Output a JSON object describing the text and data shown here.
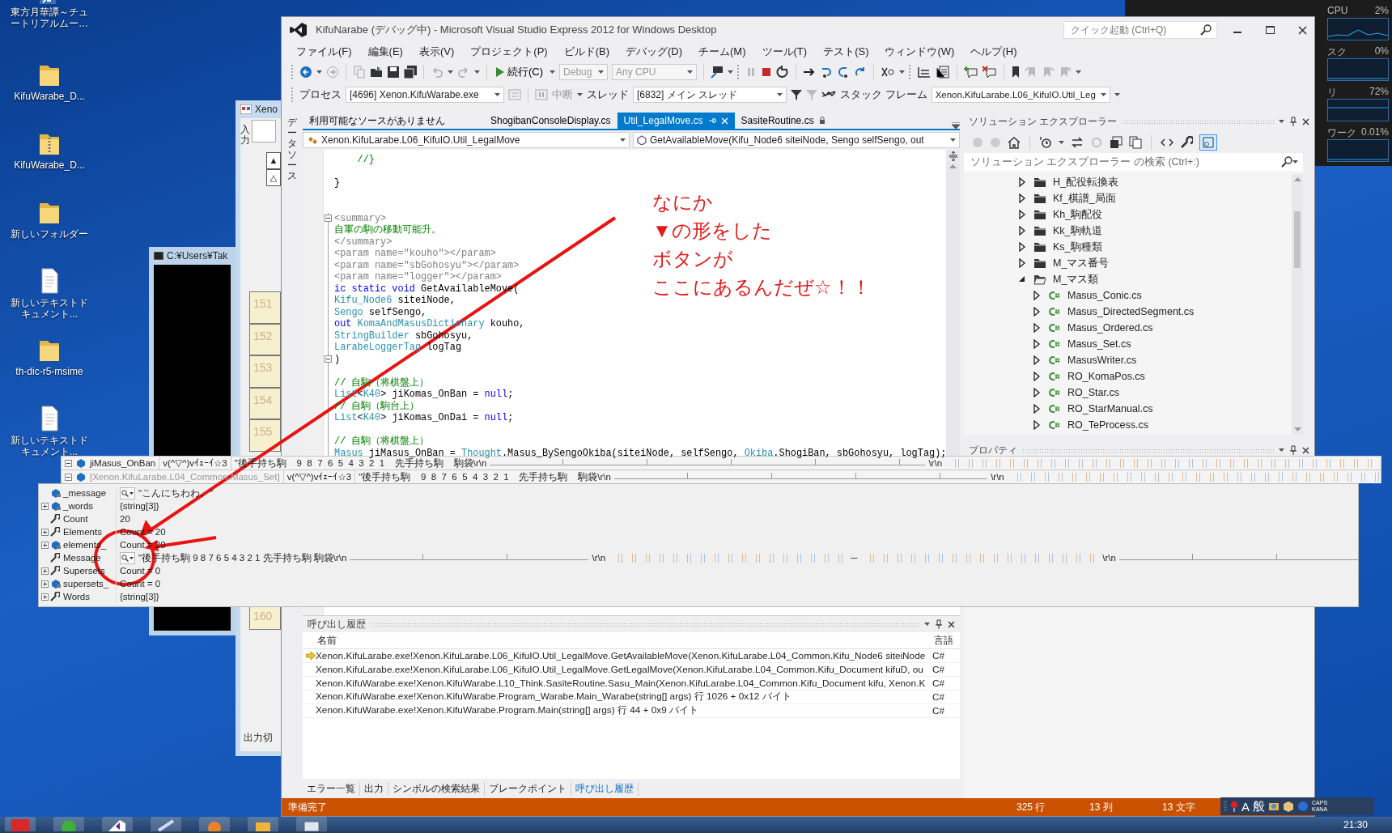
{
  "desktop_icons": [
    {
      "label": "東方月華譚～チュートリアルムー…",
      "kind": "shortcut"
    },
    {
      "label": "KifuWarabe_D...",
      "kind": "folder"
    },
    {
      "label": "KifuWarabe_D...",
      "kind": "zip"
    },
    {
      "label": "新しいフォルダー",
      "kind": "folder"
    },
    {
      "label": "新しいテキストドキュメント...",
      "kind": "text"
    },
    {
      "label": "th-dic-r5-msime",
      "kind": "folder"
    },
    {
      "label": "新しいテキストドキュメント...",
      "kind": "text"
    }
  ],
  "resource_monitor": [
    {
      "label": "CPU",
      "value": "2%"
    },
    {
      "label": "スク",
      "value": "0%"
    },
    {
      "label": "リ",
      "value": "72%"
    },
    {
      "label": "ワーク",
      "value": "0.01%"
    }
  ],
  "console_window": {
    "title": "C:¥Users¥Tak"
  },
  "xenon_window": {
    "title": "Xeno",
    "input_label": "入力",
    "marks": [
      "▲",
      "△"
    ],
    "cells": [
      "151",
      "152",
      "153",
      "154",
      "155",
      "160"
    ],
    "output_label": "出力切"
  },
  "window": {
    "title": "KifuNarabe (デバッグ中) - Microsoft Visual Studio Express 2012 for Windows Desktop",
    "quick_launch": {
      "placeholder": "クイック起動 (Ctrl+Q)"
    },
    "menu": [
      "ファイル(F)",
      "編集(E)",
      "表示(V)",
      "プロジェクト(P)",
      "ビルド(B)",
      "デバッグ(D)",
      "チーム(M)",
      "ツール(T)",
      "テスト(S)",
      "ウィンドウ(W)",
      "ヘルプ(H)"
    ],
    "toolbar": {
      "continue": "続行(C)",
      "configuration": "Debug",
      "platform": "Any CPU"
    },
    "debug_location": {
      "process_label": "プロセス",
      "process": "[4696] Xenon.KifuWarabe.exe",
      "suspend": "中断",
      "thread_label": "スレッド",
      "thread": "[6832] メイン スレッド",
      "stack_frame_label": "スタック フレーム",
      "stack_frame": "Xenon.KifuLarabe.L06_KifuIO.Util_Leg"
    },
    "side_tab": "データソース",
    "editor_tabs": [
      {
        "label": "利用可能なソースがありません",
        "selected": false,
        "kind": "plain"
      },
      {
        "label": "ShogibanConsoleDisplay.cs",
        "selected": false,
        "kind": "plain"
      },
      {
        "label": "Util_LegalMove.cs",
        "selected": true,
        "kind": "plain"
      },
      {
        "label": "SasiteRoutine.cs",
        "selected": false,
        "kind": "readonly"
      }
    ],
    "navigation": {
      "type": "Xenon.KifuLarabe.L06_KifuIO.Util_LegalMove",
      "member": "GetAvailableMove(Kifu_Node6 siteiNode, Sengo selfSengo, out"
    },
    "code_lines": [
      {
        "fold": false,
        "tokens": [
          {
            "kind": "comment",
            "text": "    //}"
          }
        ]
      },
      {
        "fold": false
      },
      {
        "fold": false,
        "tokens": [
          {
            "kind": "plain",
            "text": "}"
          }
        ]
      },
      {
        "fold": false
      },
      {
        "fold": false
      },
      {
        "fold": true,
        "tokens": [
          {
            "kind": "doc",
            "text": "<summary>"
          }
        ]
      },
      {
        "fold": false,
        "tokens": [
          {
            "kind": "comment",
            "text": "自軍の駒の移動可能升。"
          }
        ]
      },
      {
        "fold": false,
        "tokens": [
          {
            "kind": "doc",
            "text": "</summary>"
          }
        ]
      },
      {
        "fold": false,
        "tokens": [
          {
            "kind": "doc",
            "text": "<param name=\"kouho\"></param>"
          }
        ]
      },
      {
        "fold": false,
        "tokens": [
          {
            "kind": "doc",
            "text": "<param name=\"sbGohosyu\"></param>"
          }
        ]
      },
      {
        "fold": false,
        "tokens": [
          {
            "kind": "doc",
            "text": "<param name=\"logger\"></param>"
          }
        ]
      },
      {
        "fold": false,
        "tokens": [
          {
            "kind": "kw",
            "text": "ic static void"
          },
          {
            "kind": "plain",
            "text": " GetAvailableMove("
          }
        ]
      },
      {
        "fold": false,
        "tokens": [
          {
            "kind": "type",
            "text": "Kifu_Node6"
          },
          {
            "kind": "plain",
            "text": " siteiNode,"
          }
        ]
      },
      {
        "fold": false,
        "tokens": [
          {
            "kind": "type",
            "text": "Sengo"
          },
          {
            "kind": "plain",
            "text": " selfSengo,"
          }
        ]
      },
      {
        "fold": false,
        "tokens": [
          {
            "kind": "kw",
            "text": "out "
          },
          {
            "kind": "type",
            "text": "KomaAndMasusDictionary"
          },
          {
            "kind": "plain",
            "text": " kouho,"
          }
        ]
      },
      {
        "fold": false,
        "tokens": [
          {
            "kind": "type",
            "text": "StringBuilder"
          },
          {
            "kind": "plain",
            "text": " sbGohosyu,"
          }
        ]
      },
      {
        "fold": false,
        "tokens": [
          {
            "kind": "type",
            "text": "LarabeLoggerTag"
          },
          {
            "kind": "plain",
            "text": " logTag"
          }
        ]
      },
      {
        "fold": true,
        "tokens": [
          {
            "kind": "plain",
            "text": ")"
          }
        ]
      },
      {
        "fold": false
      },
      {
        "fold": false,
        "tokens": [
          {
            "kind": "comment",
            "text": "// 自駒（将棋盤上）"
          }
        ]
      },
      {
        "fold": false,
        "tokens": [
          {
            "kind": "type",
            "text": "List"
          },
          {
            "kind": "plain",
            "text": "<"
          },
          {
            "kind": "type",
            "text": "K40"
          },
          {
            "kind": "plain",
            "text": "> jiKomas_OnBan = "
          },
          {
            "kind": "kw",
            "text": "null"
          },
          {
            "kind": "plain",
            "text": ";"
          }
        ]
      },
      {
        "fold": false,
        "tokens": [
          {
            "kind": "comment",
            "text": "// 自駒（駒台上）"
          }
        ]
      },
      {
        "fold": false,
        "tokens": [
          {
            "kind": "type",
            "text": "List"
          },
          {
            "kind": "plain",
            "text": "<"
          },
          {
            "kind": "type",
            "text": "K40"
          },
          {
            "kind": "plain",
            "text": "> jiKomas_OnDai = "
          },
          {
            "kind": "kw",
            "text": "null"
          },
          {
            "kind": "plain",
            "text": ";"
          }
        ]
      },
      {
        "fold": false
      },
      {
        "fold": false,
        "tokens": [
          {
            "kind": "comment",
            "text": "// 自駒（将棋盤上）"
          }
        ]
      },
      {
        "fold": false,
        "tokens": [
          {
            "kind": "type",
            "text": "Masus"
          },
          {
            "kind": "plain",
            "text": " jiMasus_OnBan = "
          },
          {
            "kind": "type",
            "text": "Thought"
          },
          {
            "kind": "plain",
            "text": ".Masus_BySengoOkiba(siteiNode, selfSengo, "
          },
          {
            "kind": "type",
            "text": "Okiba"
          },
          {
            "kind": "plain",
            "text": ".ShogiBan, sbGohosyu, logTag);"
          }
        ]
      }
    ],
    "solution_explorer": {
      "title": "ソリューション エクスプローラー",
      "search": {
        "placeholder": "ソリューション エクスプローラー の検索 (Ctrl+:)"
      },
      "tree": [
        {
          "label": "H_配役転換表",
          "kind": "folder",
          "expanded": false
        },
        {
          "label": "Kf_棋譜_局面",
          "kind": "folder",
          "expanded": false
        },
        {
          "label": "Kh_駒配役",
          "kind": "folder",
          "expanded": false
        },
        {
          "label": "Kk_駒軌道",
          "kind": "folder",
          "expanded": false
        },
        {
          "label": "Ks_駒種類",
          "kind": "folder",
          "expanded": false
        },
        {
          "label": "M_マス番号",
          "kind": "folder",
          "expanded": false
        },
        {
          "label": "M_マス類",
          "kind": "folder",
          "expanded": true,
          "children": [
            {
              "label": "Masus_Conic.cs",
              "kind": "cs",
              "expanded": false
            },
            {
              "label": "Masus_DirectedSegment.cs",
              "kind": "cs",
              "expanded": false
            },
            {
              "label": "Masus_Ordered.cs",
              "kind": "cs",
              "expanded": false
            },
            {
              "label": "Masus_Set.cs",
              "kind": "cs",
              "expanded": false
            },
            {
              "label": "MasusWriter.cs",
              "kind": "cs",
              "expanded": false
            },
            {
              "label": "RO_KomaPos.cs",
              "kind": "cs",
              "expanded": false
            },
            {
              "label": "RO_Star.cs",
              "kind": "cs",
              "expanded": false
            },
            {
              "label": "RO_StarManual.cs",
              "kind": "cs",
              "expanded": false
            },
            {
              "label": "RO_TeProcess.cs",
              "kind": "cs",
              "expanded": false
            }
          ]
        }
      ]
    },
    "properties": {
      "title": "プロパティ"
    },
    "call_stack": {
      "title": "呼び出し履歴",
      "columns": [
        "名前",
        "言語"
      ],
      "rows": [
        {
          "name": "Xenon.KifuLarabe.exe!Xenon.KifuLarabe.L06_KifuIO.Util_LegalMove.GetAvailableMove(Xenon.KifuLarabe.L04_Common.Kifu_Node6 siteiNode",
          "language": "C#",
          "current": true
        },
        {
          "name": "Xenon.KifuLarabe.exe!Xenon.KifuLarabe.L06_KifuIO.Util_LegalMove.GetLegalMove(Xenon.KifuLarabe.L04_Common.Kifu_Document kifuD, ou",
          "language": "C#",
          "current": false
        },
        {
          "name": "Xenon.KifuWarabe.exe!Xenon.KifuWarabe.L10_Think.SasiteRoutine.Sasu_Main(Xenon.KifuLarabe.L04_Common.Kifu_Document kifu, Xenon.K",
          "language": "C#",
          "current": false
        },
        {
          "name": "Xenon.KifuWarabe.exe!Xenon.KifuWarabe.Program_Warabe.Main_Warabe(string[] args) 行 1026 + 0x12 バイト",
          "language": "C#",
          "current": false
        },
        {
          "name": "Xenon.KifuWarabe.exe!Xenon.KifuWarabe.Program.Main(string[] args) 行 44 + 0x9 バイト",
          "language": "C#",
          "current": false
        }
      ]
    },
    "bottom_tabs": [
      {
        "label": "エラー一覧",
        "selected": false
      },
      {
        "label": "出力",
        "selected": false
      },
      {
        "label": "シンボルの検索結果",
        "selected": false
      },
      {
        "label": "ブレークポイント",
        "selected": false
      },
      {
        "label": "呼び出し履歴",
        "selected": true
      }
    ],
    "status_bar": {
      "message": "準備完了",
      "line": "325 行",
      "column": "13 列",
      "char": "13 文字"
    }
  },
  "annotation": [
    "なにか",
    "▼の形をした",
    "ボタンが",
    "ここにあるんだぜ☆！！"
  ],
  "datatip": {
    "pinned": [
      {
        "name": "jiMasus_OnBan",
        "value": "v(^▽^)vｲｪｰｲ☆3",
        "dim": false,
        "segments": [
          {
            "kind": "text",
            "text": "\"後手持ち駒    9  8  7  6  5  4  3  2  1    先手持ち駒    駒袋\\r\\n"
          },
          {
            "kind": "rule"
          },
          {
            "kind": "text",
            "text": "\\r\\n"
          },
          {
            "kind": "ticks"
          }
        ]
      },
      {
        "name": "[Xenon.KifuLarabe.L04_Common.Masus_Set]",
        "value": "v(^▽^)vｲｪｰｲ☆3",
        "dim": true,
        "segments": [
          {
            "kind": "text",
            "text": "\"後手持ち駒    9  8  7  6  5  4  3  2  1    先手持ち駒    駒袋\\r\\n"
          },
          {
            "kind": "rule"
          },
          {
            "kind": "text",
            "text": "\\r\\n"
          },
          {
            "kind": "ticks"
          }
        ]
      }
    ],
    "members": [
      {
        "name": "_message",
        "kind": "field",
        "expandable": false,
        "visualizer": true,
        "segments": [
          {
            "kind": "text",
            "text": "\"こんにちわわ。\""
          }
        ]
      },
      {
        "name": "_words",
        "kind": "field",
        "expandable": true,
        "visualizer": false,
        "segments": [
          {
            "kind": "text",
            "text": "{string[3]}"
          }
        ]
      },
      {
        "name": "Count",
        "kind": "property",
        "expandable": false,
        "visualizer": false,
        "segments": [
          {
            "kind": "text",
            "text": "20"
          }
        ]
      },
      {
        "name": "Elements",
        "kind": "property",
        "expandable": true,
        "visualizer": false,
        "segments": [
          {
            "kind": "text",
            "text": "Count = 20"
          }
        ]
      },
      {
        "name": "elements_",
        "kind": "field",
        "expandable": true,
        "visualizer": false,
        "segments": [
          {
            "kind": "text",
            "text": "Count = 20"
          }
        ]
      },
      {
        "name": "Message",
        "kind": "property",
        "expandable": false,
        "visualizer": true,
        "segments": [
          {
            "kind": "text",
            "text": "\"後手持ち駒    9  8  7  6  5  4  3  2  1    先手持ち駒    駒袋\\r\\n"
          },
          {
            "kind": "rule"
          },
          {
            "kind": "text",
            "text": "\\r\\n"
          },
          {
            "kind": "ticks"
          },
          {
            "kind": "text",
            "text": "─"
          },
          {
            "kind": "ticks"
          },
          {
            "kind": "text",
            "text": "\\r\\n"
          },
          {
            "kind": "rule"
          }
        ]
      },
      {
        "name": "Supersets",
        "kind": "property",
        "expandable": true,
        "visualizer": false,
        "segments": [
          {
            "kind": "text",
            "text": "Count = 0"
          }
        ]
      },
      {
        "name": "supersets_",
        "kind": "field",
        "expandable": true,
        "visualizer": false,
        "segments": [
          {
            "kind": "text",
            "text": "Count = 0"
          }
        ]
      },
      {
        "name": "Words",
        "kind": "property",
        "expandable": true,
        "visualizer": false,
        "segments": [
          {
            "kind": "text",
            "text": "{string[3]}"
          }
        ]
      }
    ]
  },
  "language_bar": {
    "ime": "A",
    "mode": "般",
    "caps": "CAPS",
    "kana": "KANA"
  },
  "taskbar": {
    "clock": "21:30"
  }
}
